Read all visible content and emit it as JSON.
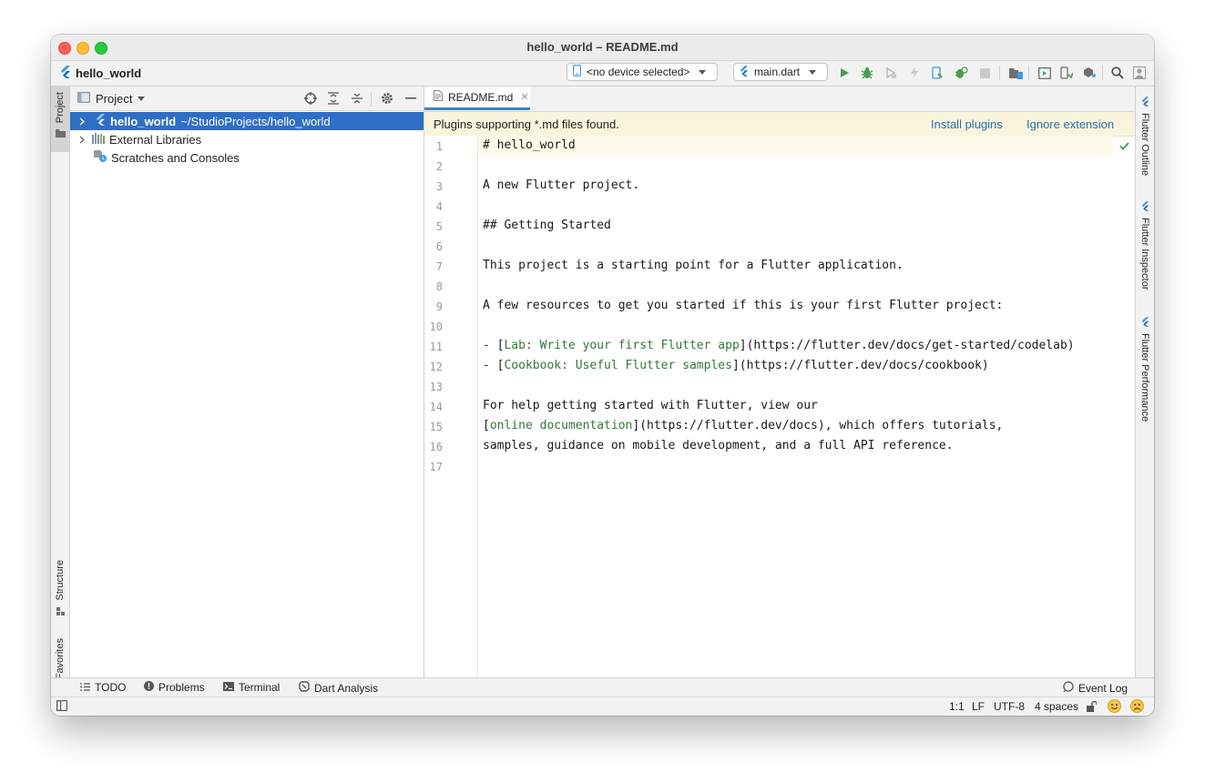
{
  "window": {
    "title": "hello_world – README.md"
  },
  "navbar": {
    "breadcrumb": "hello_world",
    "device_selector": "<no device selected>",
    "run_config": "main.dart"
  },
  "sidebar_left": {
    "tabs": [
      "Project",
      "Structure",
      "Favorites"
    ]
  },
  "sidebar_right": {
    "tabs": [
      "Flutter Outline",
      "Flutter Inspector",
      "Flutter Performance"
    ]
  },
  "project_panel": {
    "title": "Project",
    "tree": [
      {
        "name": "hello_world",
        "path": "~/StudioProjects/hello_world"
      },
      {
        "name": "External Libraries"
      },
      {
        "name": "Scratches and Consoles"
      }
    ]
  },
  "editor": {
    "tab_label": "README.md",
    "banner": {
      "message": "Plugins supporting *.md files found.",
      "install_link": "Install plugins",
      "ignore_link": "Ignore extension"
    },
    "lines": [
      {
        "n": "1",
        "segs": [
          {
            "t": "# hello_world"
          }
        ]
      },
      {
        "n": "2",
        "segs": []
      },
      {
        "n": "3",
        "segs": [
          {
            "t": "A new Flutter project."
          }
        ]
      },
      {
        "n": "4",
        "segs": []
      },
      {
        "n": "5",
        "segs": [
          {
            "t": "## Getting Started"
          }
        ]
      },
      {
        "n": "6",
        "segs": []
      },
      {
        "n": "7",
        "segs": [
          {
            "t": "This project is a starting point for a Flutter application."
          }
        ]
      },
      {
        "n": "8",
        "segs": []
      },
      {
        "n": "9",
        "segs": [
          {
            "t": "A few resources to get you started if this is your first Flutter project:"
          }
        ]
      },
      {
        "n": "10",
        "segs": []
      },
      {
        "n": "11",
        "segs": [
          {
            "t": "- ["
          },
          {
            "t": "Lab: Write your first Flutter app",
            "link": true
          },
          {
            "t": "](https://flutter.dev/docs/get-started/codelab)"
          }
        ]
      },
      {
        "n": "12",
        "segs": [
          {
            "t": "- ["
          },
          {
            "t": "Cookbook: Useful Flutter samples",
            "link": true
          },
          {
            "t": "](https://flutter.dev/docs/cookbook)"
          }
        ]
      },
      {
        "n": "13",
        "segs": []
      },
      {
        "n": "14",
        "segs": [
          {
            "t": "For help getting started with Flutter, view our"
          }
        ]
      },
      {
        "n": "15",
        "segs": [
          {
            "t": "["
          },
          {
            "t": "online documentation",
            "link": true
          },
          {
            "t": "](https://flutter.dev/docs), which offers tutorials,"
          }
        ]
      },
      {
        "n": "16",
        "segs": [
          {
            "t": "samples, guidance on mobile development, and a full API reference."
          }
        ]
      },
      {
        "n": "17",
        "segs": []
      }
    ]
  },
  "bottom_tools": [
    "TODO",
    "Problems",
    "Terminal",
    "Dart Analysis"
  ],
  "event_log": "Event Log",
  "status": {
    "position": "1:1",
    "line_sep": "LF",
    "encoding": "UTF-8",
    "indent": "4 spaces"
  },
  "colors": {
    "accent": "#2e6ec4",
    "run_green": "#499c54",
    "link_green": "#2f7a34",
    "banner_bg": "#f9f5dc",
    "flutter_blue": "#3f9ae0"
  }
}
